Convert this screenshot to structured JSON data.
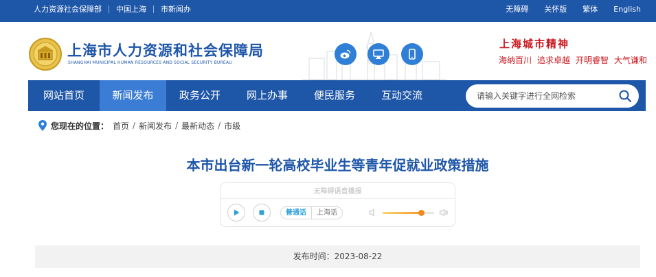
{
  "topbar": {
    "left_links": [
      "人力资源社会保障部",
      "中国上海",
      "市新闻办"
    ],
    "right_links": [
      "无障碍",
      "关怀版",
      "繁体",
      "English"
    ]
  },
  "header": {
    "title": "上海市人力资源和社会保障局",
    "subtitle": "SHANGHAI MUNICIPAL HUMAN RESOURCES AND SOCIAL SECURITY BUREAU",
    "spirit_title": "上海城市精神",
    "spirit_words": [
      "海纳百川",
      "追求卓越",
      "开明睿智",
      "大气谦和"
    ],
    "social_icons": [
      "weibo-icon",
      "desktop-icon",
      "mobile-icon"
    ]
  },
  "nav": {
    "items": [
      "网站首页",
      "新闻发布",
      "政务公开",
      "网上办事",
      "便民服务",
      "互动交流"
    ],
    "active_index": 1
  },
  "search": {
    "placeholder": "请输入关键字进行全网检索"
  },
  "breadcrumb": {
    "label": "您现在的位置：",
    "items": [
      "首页",
      "新闻发布",
      "最新动态",
      "市级"
    ]
  },
  "article": {
    "title": "本市出台新一轮高校毕业生等青年促就业政策措施",
    "publish_time": "发布时间：2023-08-22"
  },
  "player": {
    "title": "无障碍语音播报",
    "lang_mandarin": "普通话",
    "lang_shanghai": "上海话",
    "volume_fraction": 0.75
  },
  "colors": {
    "brand_blue": "#1e56a8",
    "nav_active": "#3b7dd4",
    "spirit_red": "#c9161d",
    "social_blue": "#2f7fd6"
  }
}
